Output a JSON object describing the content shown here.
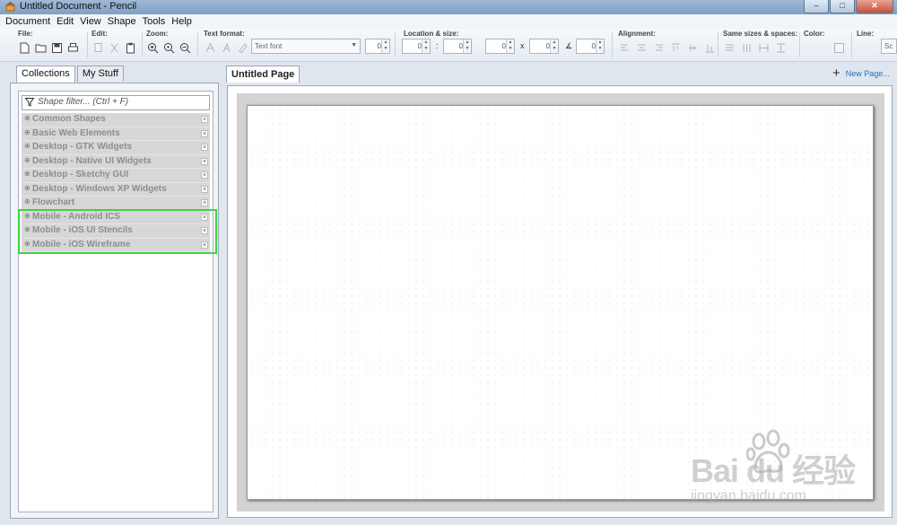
{
  "window": {
    "title": "Untitled Document - Pencil",
    "min": "–",
    "max": "□",
    "close": "✕"
  },
  "menu": [
    "Document",
    "Edit",
    "View",
    "Shape",
    "Tools",
    "Help"
  ],
  "toolbar": {
    "file_label": "File:",
    "edit_label": "Edit:",
    "zoom_label": "Zoom:",
    "text_format_label": "Text format:",
    "font_placeholder": "Text font",
    "font_size": "0",
    "location_label": "Location & size:",
    "loc_x": "0",
    "loc_sep": ":",
    "loc_y": "0",
    "size_w": "0",
    "size_x_char": "x",
    "size_h": "0",
    "angle_char": "∡",
    "angle": "0",
    "alignment_label": "Alignment:",
    "same_sizes_label": "Same sizes & spaces:",
    "color_label": "Color:",
    "line_label": "Line:",
    "line_value": "Sc"
  },
  "left_panel": {
    "tabs": [
      "Collections",
      "My Stuff"
    ],
    "filter_placeholder": "Shape filter... (Ctrl + F)",
    "collections": [
      "Common Shapes",
      "Basic Web Elements",
      "Desktop - GTK Widgets",
      "Desktop - Native UI Widgets",
      "Desktop - Sketchy GUI",
      "Desktop - Windows XP Widgets",
      "Flowchart",
      "Mobile - Android ICS",
      "Mobile - iOS UI Stencils",
      "Mobile - iOS Wireframe"
    ],
    "highlight_color": "#3fd33f"
  },
  "editor": {
    "page_tab": "Untitled Page",
    "new_page": "New Page..."
  },
  "watermark": {
    "brand": "Bai  du 经验",
    "sub": "jingyan.baidu.com"
  }
}
